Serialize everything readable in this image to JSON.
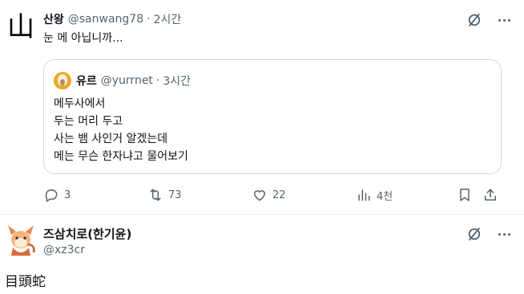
{
  "tweet": {
    "avatar_glyph": "山",
    "name": "산왕",
    "handle": "@sanwang78",
    "separator": "·",
    "time": "2시간",
    "text": "눈 메 아닙니까...",
    "quote": {
      "name": "유르",
      "handle": "@yurrnet",
      "separator": "·",
      "time": "3시간",
      "lines": [
        "메두사에서",
        "두는 머리 두고",
        "사는 뱀 사인거 알겠는데",
        "메는 무슨 한자냐고 물어보기"
      ]
    },
    "actions": {
      "replies": "3",
      "reposts": "73",
      "likes": "22",
      "views": "4천"
    }
  },
  "reply": {
    "name": "즈삼치로(한기윤)",
    "handle": "@xz3cr",
    "text": "目頭蛇"
  },
  "colors": {
    "text_primary": "#0f1419",
    "text_secondary": "#536471",
    "border": "#cfd9de"
  }
}
